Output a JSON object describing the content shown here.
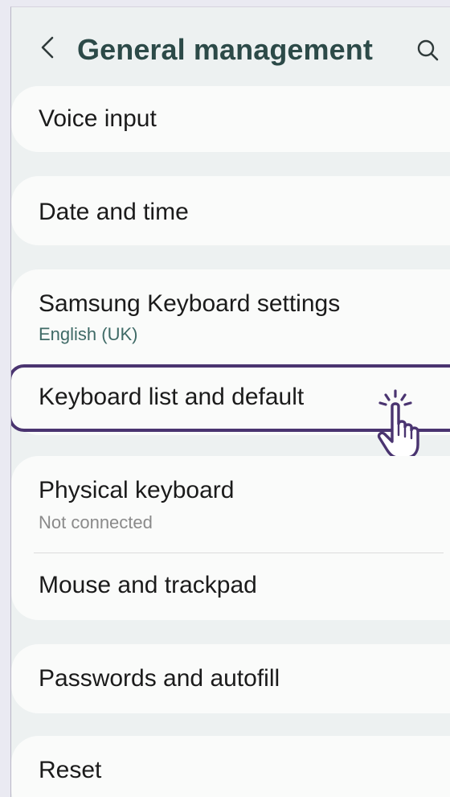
{
  "header": {
    "title": "General management",
    "back_icon": "chevron-left-icon",
    "search_icon": "search-icon"
  },
  "items": [
    {
      "label": "Voice input"
    },
    {
      "label": "Date and time"
    },
    {
      "label": "Samsung Keyboard settings",
      "subtitle": "English (UK)"
    },
    {
      "label": "Keyboard list and default",
      "highlighted": true
    },
    {
      "label": "Physical keyboard",
      "subtitle": "Not connected"
    },
    {
      "label": "Mouse and trackpad"
    },
    {
      "label": "Passwords and autofill"
    },
    {
      "label": "Reset"
    }
  ],
  "colors": {
    "accent": "#3f6a66",
    "highlight_border": "#4a3470",
    "title": "#2c4a48"
  }
}
